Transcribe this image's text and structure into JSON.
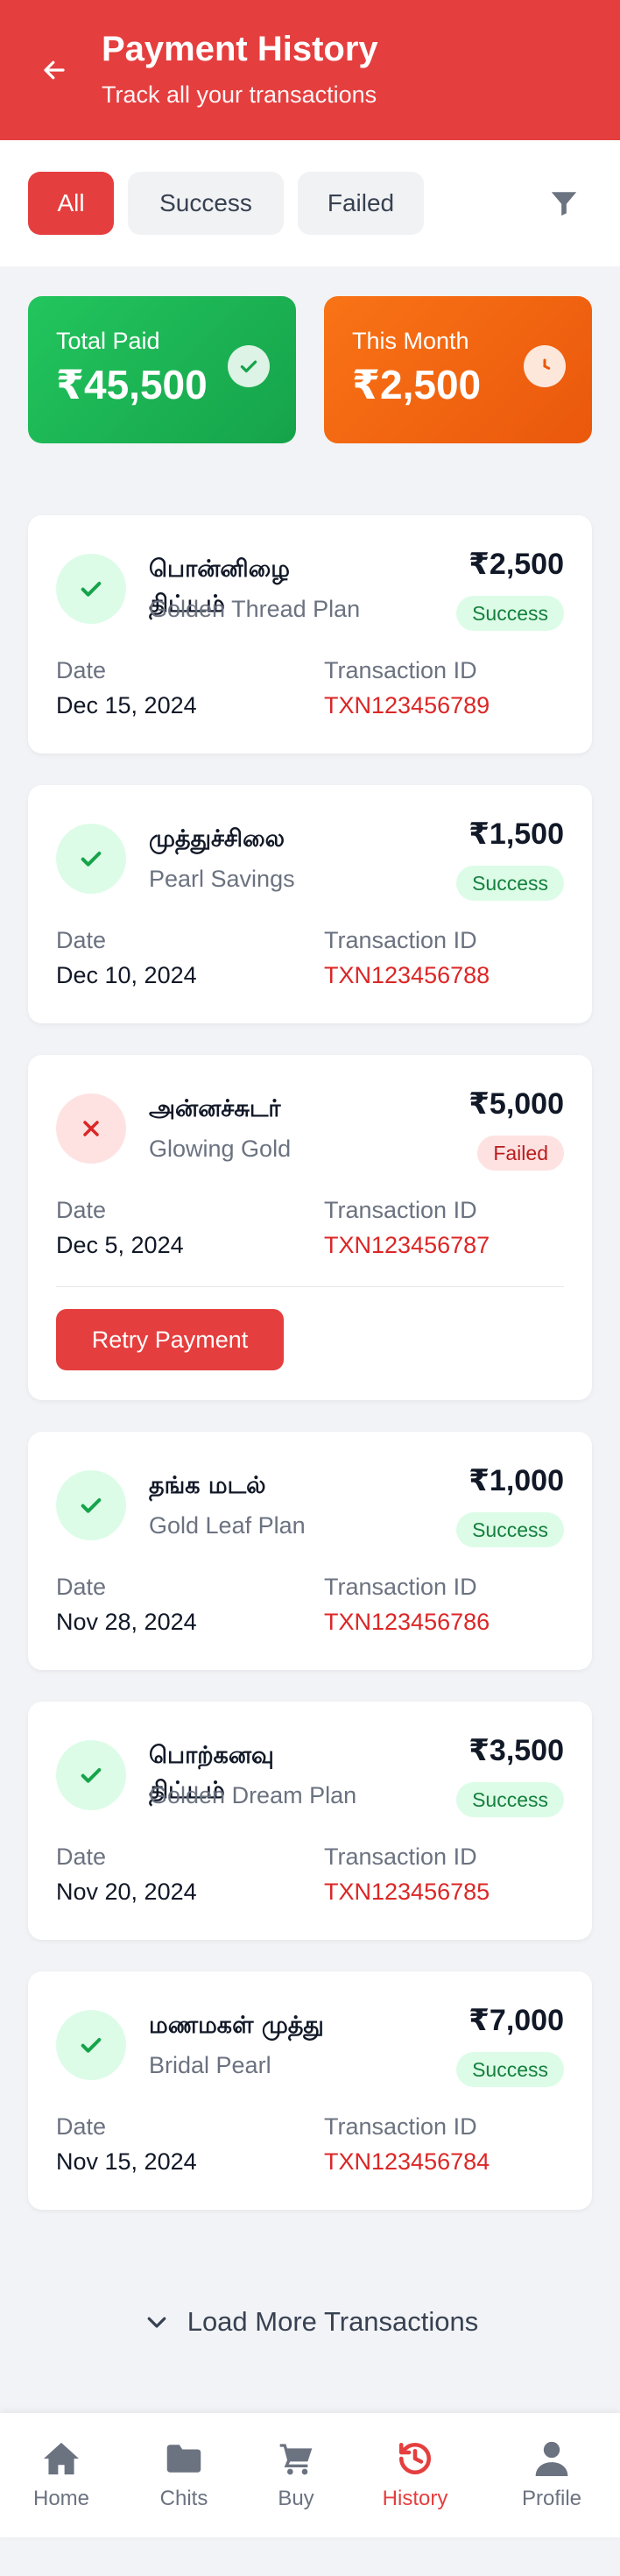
{
  "header": {
    "title": "Payment History",
    "subtitle": "Track all your transactions"
  },
  "filters": {
    "chips": [
      "All",
      "Success",
      "Failed"
    ],
    "active": "All"
  },
  "summary": {
    "total_paid_label": "Total Paid",
    "total_paid_value": "₹45,500",
    "this_month_label": "This Month",
    "this_month_value": "₹2,500"
  },
  "labels": {
    "date": "Date",
    "transaction_id": "Transaction ID",
    "retry": "Retry Payment",
    "load_more": "Load More Transactions"
  },
  "transactions": [
    {
      "name": "பொன்னிழை திட்டம்",
      "plan": "Golden Thread Plan",
      "amount": "₹2,500",
      "status": "Success",
      "date": "Dec 15, 2024",
      "txn_id": "TXN123456789"
    },
    {
      "name": "முத்துச்சிலை",
      "plan": "Pearl Savings",
      "amount": "₹1,500",
      "status": "Success",
      "date": "Dec 10, 2024",
      "txn_id": "TXN123456788"
    },
    {
      "name": "அன்னச்சுடர்",
      "plan": "Glowing Gold",
      "amount": "₹5,000",
      "status": "Failed",
      "date": "Dec 5, 2024",
      "txn_id": "TXN123456787"
    },
    {
      "name": "தங்க மடல்",
      "plan": "Gold Leaf Plan",
      "amount": "₹1,000",
      "status": "Success",
      "date": "Nov 28, 2024",
      "txn_id": "TXN123456786"
    },
    {
      "name": "பொற்கனவு திட்டம்",
      "plan": "Golden Dream Plan",
      "amount": "₹3,500",
      "status": "Success",
      "date": "Nov 20, 2024",
      "txn_id": "TXN123456785"
    },
    {
      "name": "மணமகள் முத்து",
      "plan": "Bridal Pearl",
      "amount": "₹7,000",
      "status": "Success",
      "date": "Nov 15, 2024",
      "txn_id": "TXN123456784"
    }
  ],
  "nav": {
    "items": [
      "Home",
      "Chits",
      "Buy",
      "History",
      "Profile"
    ],
    "active": "History"
  },
  "colors": {
    "brand": "#e53e3e",
    "success": "#22c55e",
    "warning": "#f97316",
    "txn_id": "#dc2626"
  },
  "icons": {
    "back": "arrow-left-icon",
    "filter": "funnel-icon",
    "total_paid": "check-circle-icon",
    "this_month": "clock-icon",
    "success": "check-icon",
    "failed": "x-icon",
    "load_more": "chevron-down-icon",
    "nav": [
      "home-icon",
      "folder-icon",
      "cart-icon",
      "history-icon",
      "user-icon"
    ]
  }
}
